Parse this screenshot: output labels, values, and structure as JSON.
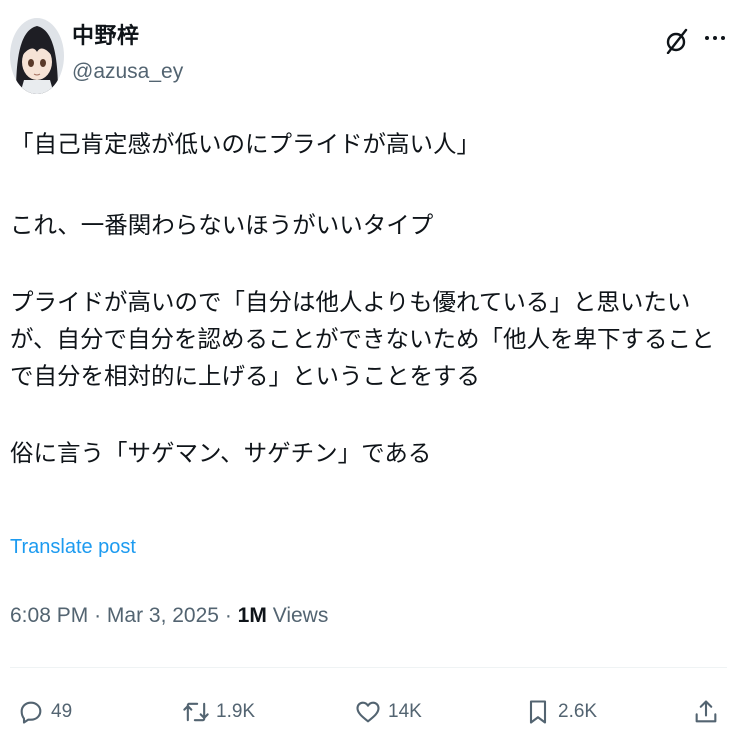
{
  "author": {
    "display_name": "中野梓",
    "handle": "@azusa_ey"
  },
  "post": {
    "paragraphs": [
      "「自己肯定感が低いのにプライドが高い人」",
      "これ、一番関わらないほうがいいタイプ",
      "プライドが高いので「自分は他人よりも優れている」と思いたいが、自分で自分を認めることができないため「他人を卑下することで自分を相対的に上げる」ということをする",
      "俗に言う「サゲマン、サゲチン」である"
    ],
    "translate_label": "Translate post"
  },
  "meta": {
    "time": "6:08 PM",
    "separator": "·",
    "date": "Mar 3, 2025",
    "views_count": "1M",
    "views_label": "Views"
  },
  "actions": {
    "replies": "49",
    "reposts": "1.9K",
    "likes": "14K",
    "bookmarks": "2.6K"
  },
  "icons": {
    "grok": "grok-icon",
    "more": "more-icon",
    "reply": "reply-icon",
    "repost": "repost-icon",
    "like": "heart-icon",
    "bookmark": "bookmark-icon",
    "share": "share-icon"
  },
  "colors": {
    "link": "#1d9bf0",
    "secondary_text": "#536471",
    "primary_text": "#0f1419"
  }
}
